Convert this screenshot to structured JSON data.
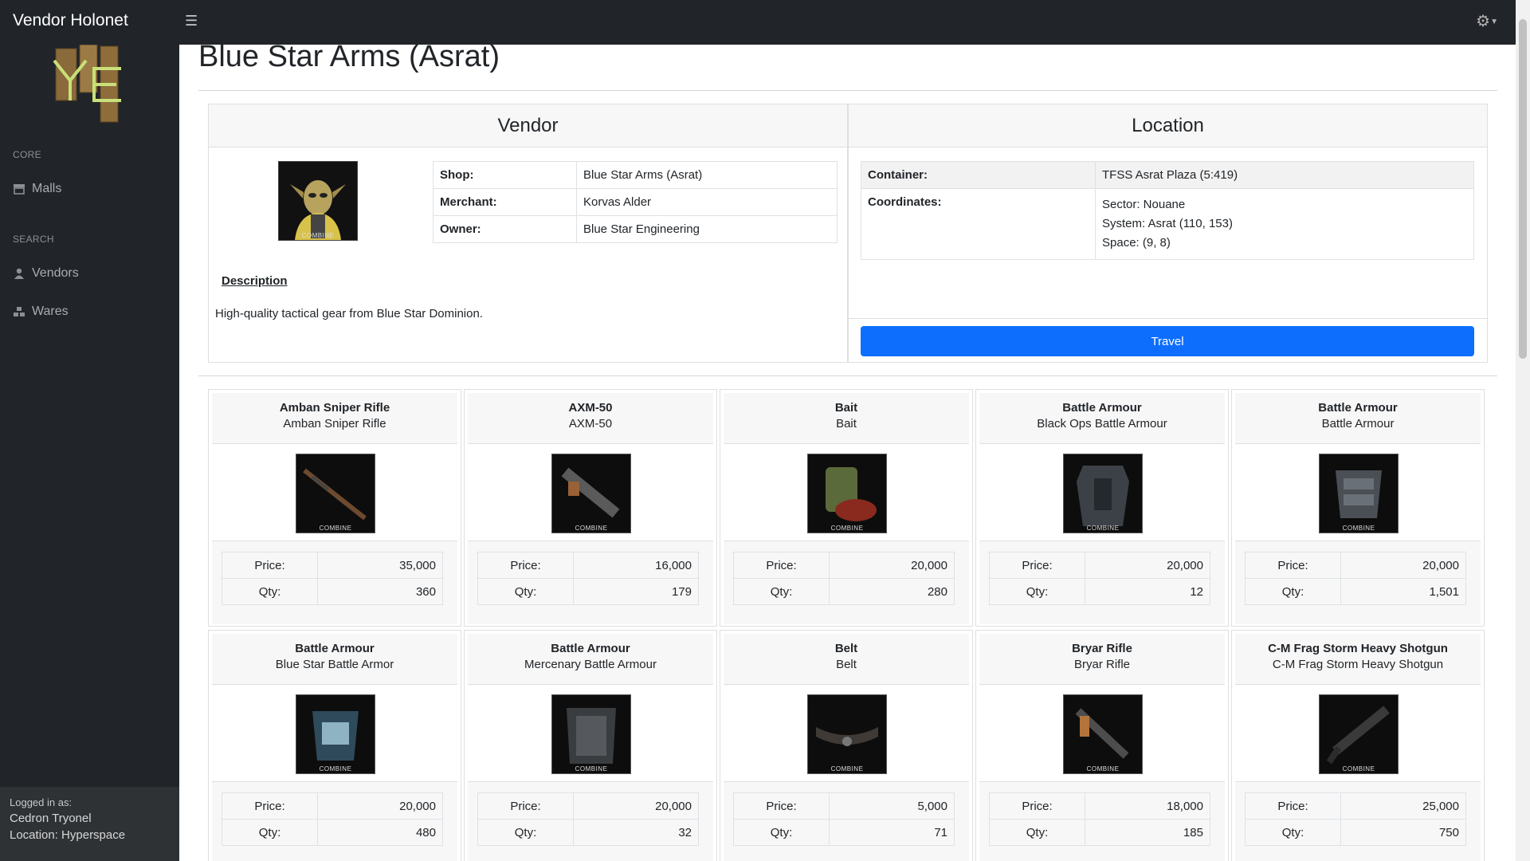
{
  "app": {
    "brand": "Vendor Holonet"
  },
  "sidebar": {
    "core_heading": "CORE",
    "malls_label": "Malls",
    "search_heading": "SEARCH",
    "vendors_label": "Vendors",
    "wares_label": "Wares",
    "footer": {
      "logged_in_label": "Logged in as:",
      "user": "Cedron Tryonel",
      "location": "Location: Hyperspace"
    }
  },
  "page": {
    "title": "Blue Star Arms (Asrat)"
  },
  "vendor_panel": {
    "heading": "Vendor",
    "rows": [
      {
        "key": "Shop:",
        "value": "Blue Star Arms (Asrat)"
      },
      {
        "key": "Merchant:",
        "value": "Korvas Alder"
      },
      {
        "key": "Owner:",
        "value": "Blue Star Engineering"
      }
    ],
    "avatar_badge": "COMBINE",
    "description_label": "Description",
    "description": "High-quality tactical gear from Blue Star Dominion."
  },
  "location_panel": {
    "heading": "Location",
    "container_key": "Container:",
    "container_value": "TFSS Asrat Plaza (5:419)",
    "coordinates_key": "Coordinates:",
    "sector": "Sector: Nouane",
    "system": "System: Asrat (110, 153)",
    "space": "Space: (9, 8)",
    "travel_button": "Travel"
  },
  "labels": {
    "price": "Price:",
    "qty": "Qty:",
    "badge": "COMBINE"
  },
  "wares": [
    {
      "name": "Amban Sniper Rifle",
      "sub": "Amban Sniper Rifle",
      "price": "35,000",
      "qty": "360",
      "icon": "sniper-rifle-icon"
    },
    {
      "name": "AXM-50",
      "sub": "AXM-50",
      "price": "16,000",
      "qty": "179",
      "icon": "launcher-icon"
    },
    {
      "name": "Bait",
      "sub": "Bait",
      "price": "20,000",
      "qty": "280",
      "icon": "bait-can-icon"
    },
    {
      "name": "Battle Armour",
      "sub": "Black Ops Battle Armour",
      "price": "20,000",
      "qty": "12",
      "icon": "armour-icon"
    },
    {
      "name": "Battle Armour",
      "sub": "Battle Armour",
      "price": "20,000",
      "qty": "1,501",
      "icon": "armour-icon"
    },
    {
      "name": "Battle Armour",
      "sub": "Blue Star Battle Armor",
      "price": "20,000",
      "qty": "480",
      "icon": "armour-icon"
    },
    {
      "name": "Battle Armour",
      "sub": "Mercenary Battle Armour",
      "price": "20,000",
      "qty": "32",
      "icon": "armour-icon"
    },
    {
      "name": "Belt",
      "sub": "Belt",
      "price": "5,000",
      "qty": "71",
      "icon": "belt-icon"
    },
    {
      "name": "Bryar Rifle",
      "sub": "Bryar Rifle",
      "price": "18,000",
      "qty": "185",
      "icon": "rifle-icon"
    },
    {
      "name": "C-M Frag Storm Heavy Shotgun",
      "sub": "C-M Frag Storm Heavy Shotgun",
      "price": "25,000",
      "qty": "750",
      "icon": "shotgun-icon"
    }
  ],
  "colors": {
    "sidebar": "#212529",
    "accent": "#0d6efd"
  }
}
